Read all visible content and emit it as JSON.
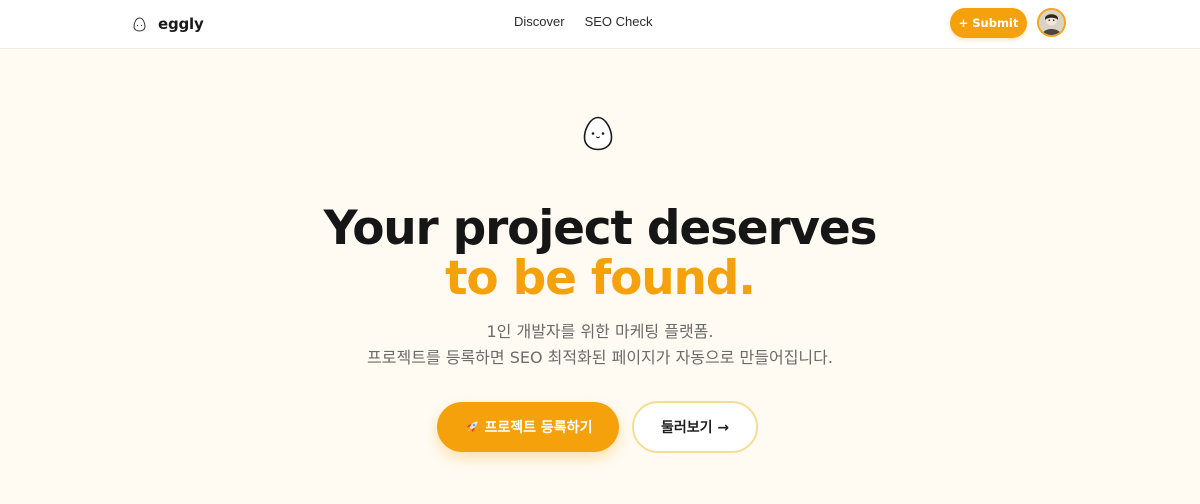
{
  "header": {
    "brand": "eggly",
    "nav": [
      {
        "label": "Discover"
      },
      {
        "label": "SEO Check"
      }
    ],
    "submit_label": "+ Submit"
  },
  "hero": {
    "headline_line1": "Your project deserves",
    "headline_line2": "to be found.",
    "subtitle_line1": "1인 개발자를 위한 마케팅 플랫폼.",
    "subtitle_line2": "프로젝트를 등록하면 SEO 최적화된 페이지가 자동으로 만들어집니다.",
    "primary_cta_label": "프로젝트 등록하기",
    "primary_cta_icon": "rocket-icon",
    "secondary_cta_label": "둘러보기 →"
  },
  "colors": {
    "accent": "#f5a10c",
    "background": "#fffbf3",
    "text": "#161616",
    "muted_text": "#6b6b6b",
    "secondary_border": "#f6dc95"
  }
}
